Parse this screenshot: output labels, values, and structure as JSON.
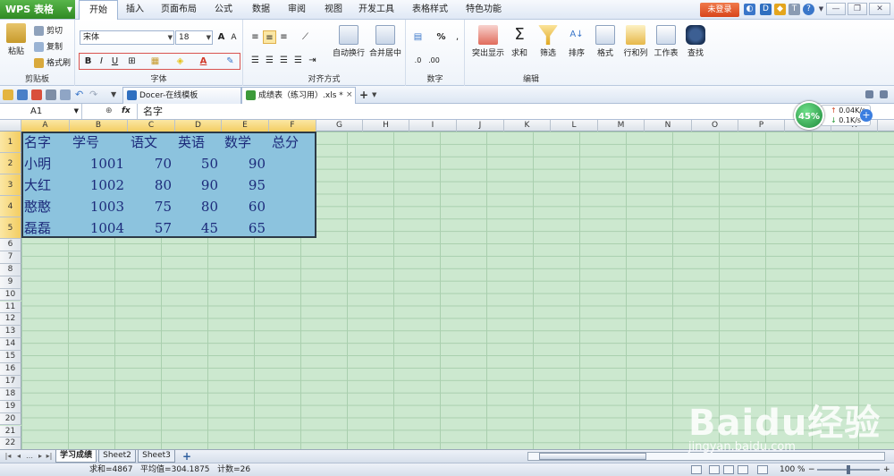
{
  "menubar": {
    "logo": "WPS 表格",
    "tabs": [
      "开始",
      "插入",
      "页面布局",
      "公式",
      "数据",
      "审阅",
      "视图",
      "开发工具",
      "表格样式",
      "特色功能"
    ],
    "login": "未登录"
  },
  "ribbon": {
    "clipboard": {
      "paste": "粘贴",
      "cut": "剪切",
      "copy": "复制",
      "format_painter": "格式刷",
      "label": "剪贴板"
    },
    "font": {
      "name": "宋体",
      "size": "18",
      "bold": "B",
      "italic": "I",
      "underline": "U",
      "label": "字体"
    },
    "align": {
      "wrap": "自动换行",
      "merge": "合并居中",
      "label": "对齐方式"
    },
    "number": {
      "percent": "%",
      "label": "数字"
    },
    "edit": {
      "highlight": "突出显示",
      "sum": "求和",
      "filter": "筛选",
      "sort": "排序",
      "format": "格式",
      "rowcol": "行和列",
      "sheet": "工作表",
      "find": "查找",
      "label": "编辑"
    }
  },
  "doctabs": [
    "Docer-在线模板",
    "成绩表（练习用）.xls *"
  ],
  "formula": {
    "namebox": "A1",
    "fx": "fx",
    "content": "名字"
  },
  "columns": [
    "A",
    "B",
    "C",
    "D",
    "E",
    "F",
    "G",
    "H",
    "I",
    "J",
    "K",
    "L",
    "M",
    "N",
    "O",
    "P",
    "Q",
    "R"
  ],
  "rows": [
    "1",
    "2",
    "3",
    "4",
    "5",
    "6",
    "7",
    "8",
    "9",
    "10",
    "11",
    "12",
    "13",
    "14",
    "15",
    "16",
    "17",
    "18",
    "19",
    "20",
    "21",
    "22"
  ],
  "table": {
    "header": [
      "名字",
      "学号",
      "语文",
      "英语",
      "数学",
      "总分"
    ],
    "rows": [
      [
        "小明",
        "1001",
        "70",
        "50",
        "90",
        ""
      ],
      [
        "大红",
        "1002",
        "80",
        "90",
        "95",
        ""
      ],
      [
        "憨憨",
        "1003",
        "75",
        "80",
        "60",
        ""
      ],
      [
        "磊磊",
        "1004",
        "57",
        "45",
        "65",
        ""
      ]
    ]
  },
  "sheets": [
    "学习成绩",
    "Sheet2",
    "Sheet3"
  ],
  "status": {
    "sum": "求和=4867",
    "avg": "平均值=304.1875",
    "count": "计数=26",
    "zoom": "100 %"
  },
  "speed": {
    "percent": "45%",
    "up": "0.04K/s",
    "down": "0.1K/s"
  },
  "watermark": {
    "brand": "Baidu经验",
    "url": "jingyan.baidu.com"
  },
  "colors": {
    "accent": "#2f8a23",
    "selection": "#8cc3de",
    "grid_bg": "#cce8cf",
    "cell_text": "#1c2a7a"
  }
}
